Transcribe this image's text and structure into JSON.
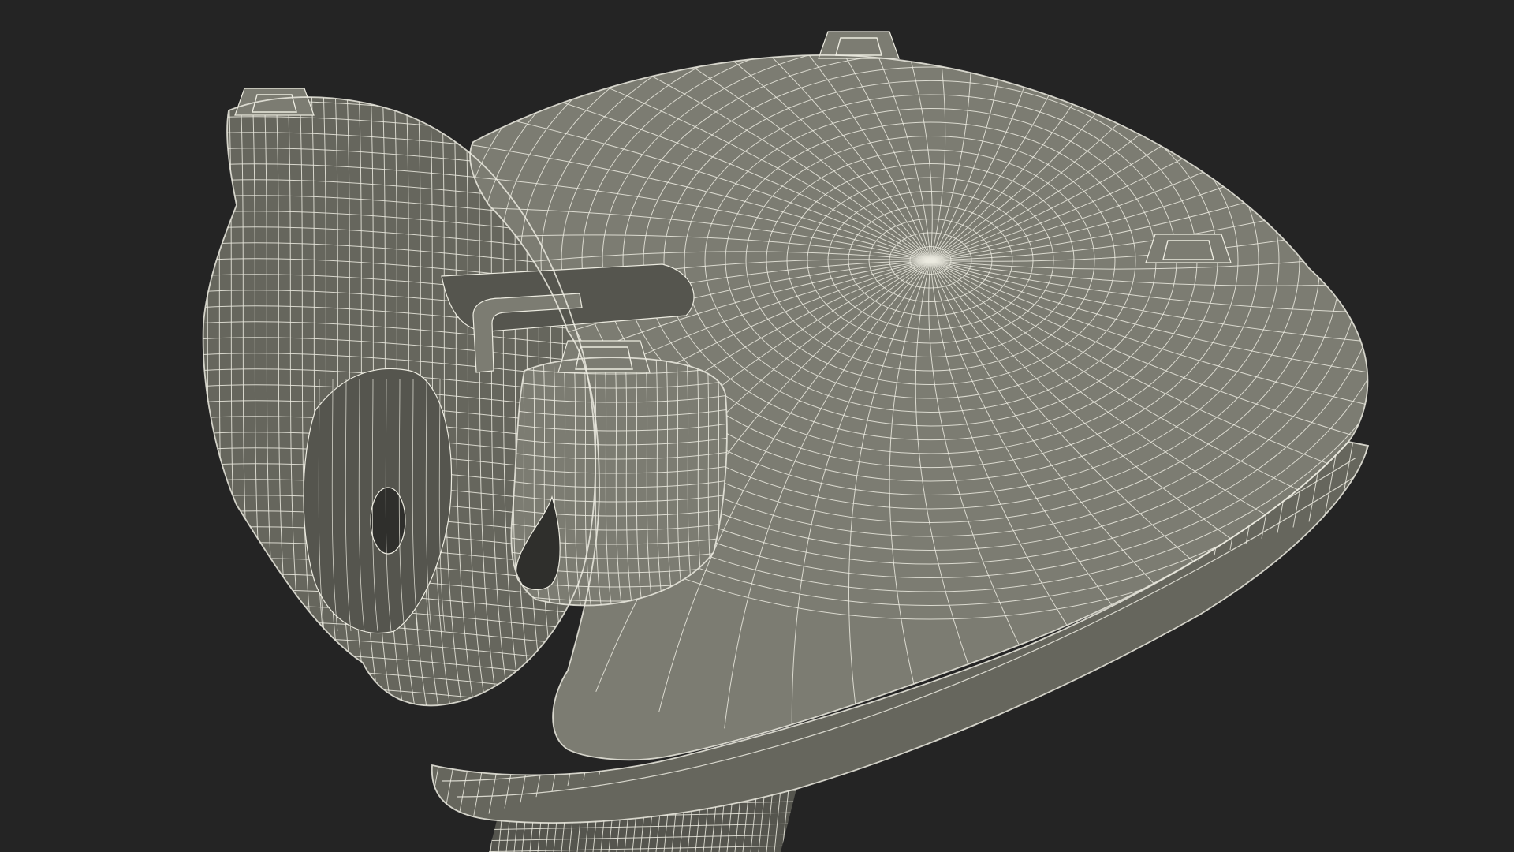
{
  "scene": {
    "subject": "wireframe-3d-model",
    "colors": {
      "background": "#242424",
      "surface": "#7c7c72",
      "surface_dark": "#66665d",
      "surface_shadow": "#55554e",
      "wire": "#ecebe0",
      "hole": "#2f2f2c"
    }
  }
}
